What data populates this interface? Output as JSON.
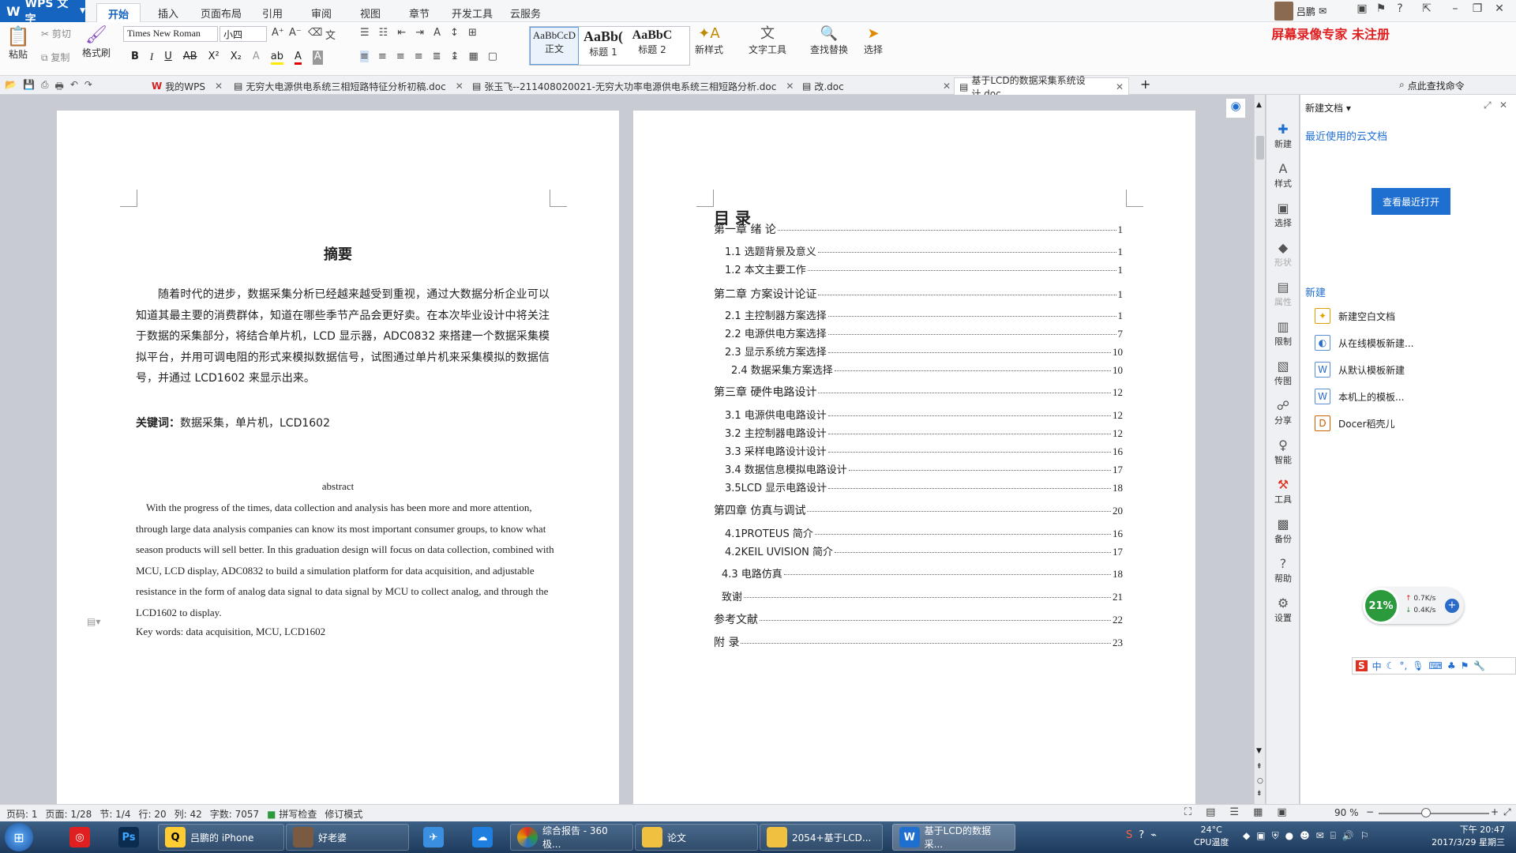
{
  "app": {
    "name": "WPS 文字",
    "logo": "W"
  },
  "menu_tabs": [
    {
      "label": "开始"
    },
    {
      "label": "插入"
    },
    {
      "label": "页面布局"
    },
    {
      "label": "引用"
    },
    {
      "label": "审阅"
    },
    {
      "label": "视图"
    },
    {
      "label": "章节"
    },
    {
      "label": "开发工具"
    },
    {
      "label": "云服务"
    }
  ],
  "user": {
    "name": "吕鹏"
  },
  "watermark": "屏幕录像专家  未注册",
  "ribbon": {
    "paste": "粘贴",
    "cut": "剪切",
    "copy": "复制",
    "format_painter": "格式刷",
    "font_name": "Times New Roman",
    "font_size": "小四",
    "styles": [
      {
        "preview": "AaBbCcD",
        "label": "正文"
      },
      {
        "preview": "AaBb(",
        "label": "标题 1"
      },
      {
        "preview": "AaBbC",
        "label": "标题 2"
      }
    ],
    "new_style": "新样式",
    "text_tools": "文字工具",
    "find_replace": "查找替换",
    "select": "选择"
  },
  "doc_tabs": [
    {
      "label": "我的WPS"
    },
    {
      "label": "无穷大电源供电系统三相短路特征分析初稿.doc"
    },
    {
      "label": "张玉飞--211408020021-无穷大功率电源供电系统三相短路分析.doc"
    },
    {
      "label": "改.doc"
    },
    {
      "label": "基于LCD的数据采集系统设计.doc"
    }
  ],
  "find_command": "点此查找命令",
  "page1": {
    "title": "摘要",
    "abstract_cn": "随着时代的进步，数据采集分析已经越来越受到重视，通过大数据分析企业可以知道其最主要的消费群体，知道在哪些季节产品会更好卖。在本次毕业设计中将关注于数据的采集部分，将结合单片机，LCD 显示器，ADC0832 来搭建一个数据采集模拟平台，并用可调电阻的形式来模拟数据信号，试图通过单片机来采集模拟的数据信号，并通过 LCD1602 来显示出来。",
    "keywords_label": "关键词：",
    "keywords": "数据采集，单片机，LCD1602",
    "abstract_en_title": "abstract",
    "abstract_en": "With the progress of the times, data collection and analysis has been more and more attention, through large data analysis companies can know its most important consumer groups, to know what season products will sell better. In this graduation design will focus on data collection, combined with MCU, LCD display, ADC0832 to build a simulation platform for data acquisition, and adjustable resistance in the form of analog data signal to data signal by MCU to collect analog, and through the LCD1602 to display.",
    "keywords_en": "Key words: data acquisition, MCU, LCD1602"
  },
  "page2": {
    "title": "目 录",
    "toc": [
      {
        "text": "第一章  绪  论",
        "page": "1"
      },
      {
        "text": "1.1 选题背景及意义",
        "page": "1"
      },
      {
        "text": "1.2 本文主要工作",
        "page": "1"
      },
      {
        "text": "第二章  方案设计论证",
        "page": "1"
      },
      {
        "text": "2.1 主控制器方案选择",
        "page": "1"
      },
      {
        "text": "2.2 电源供电方案选择",
        "page": "7"
      },
      {
        "text": "2.3  显示系统方案选择",
        "page": "10"
      },
      {
        "text": "2.4 数据采集方案选择",
        "page": "10"
      },
      {
        "text": "第三章  硬件电路设计",
        "page": "12"
      },
      {
        "text": "3.1 电源供电电路设计",
        "page": "12"
      },
      {
        "text": "3.2 主控制器电路设计",
        "page": "12"
      },
      {
        "text": "3.3 采样电路设计设计",
        "page": "16"
      },
      {
        "text": "3.4  数据信息模拟电路设计",
        "page": "17"
      },
      {
        "text": "3.5LCD 显示电路设计",
        "page": "18"
      },
      {
        "text": "第四章    仿真与调试",
        "page": "20"
      },
      {
        "text": "4.1PROTEUS 简介",
        "page": "16"
      },
      {
        "text": "4.2KEIL UVISION 简介",
        "page": "17"
      },
      {
        "text": "4.3 电路仿真",
        "page": "18"
      },
      {
        "text": "致谢",
        "page": "21"
      },
      {
        "text": "参考文献",
        "page": "22"
      },
      {
        "text": "附  录",
        "page": "23"
      }
    ]
  },
  "side_tools": [
    {
      "label": "新建"
    },
    {
      "label": "样式"
    },
    {
      "label": "选择"
    },
    {
      "label": "形状"
    },
    {
      "label": "属性"
    },
    {
      "label": "限制"
    },
    {
      "label": "传图"
    },
    {
      "label": "分享"
    },
    {
      "label": "智能"
    },
    {
      "label": "工具"
    },
    {
      "label": "备份"
    },
    {
      "label": "帮助"
    },
    {
      "label": "设置"
    }
  ],
  "right_panel": {
    "header": "新建文档",
    "recent_title": "最近使用的云文档",
    "recent_button": "查看最近打开",
    "new_title": "新建",
    "items": [
      {
        "label": "新建空白文档"
      },
      {
        "label": "从在线模板新建..."
      },
      {
        "label": "从默认模板新建"
      },
      {
        "label": "本机上的模板..."
      },
      {
        "label": "Docer稻壳儿"
      }
    ]
  },
  "net_meter": {
    "percent": "21%",
    "up": "0.7K/s",
    "down": "0.4K/s"
  },
  "status": {
    "page_num": "页码: 1",
    "page": "页面: 1/28",
    "section": "节: 1/4",
    "row": "行: 20",
    "col": "列: 42",
    "words": "字数: 7057",
    "spell": "拼写检查",
    "mode": "修订模式",
    "zoom": "90 %"
  },
  "taskbar": {
    "items": [
      {
        "label": "吕鹏的 iPhone"
      },
      {
        "label": "好老婆"
      },
      {
        "label": "综合报告 - 360极..."
      },
      {
        "label": "论文"
      },
      {
        "label": "2054+基于LCD..."
      },
      {
        "label": "基于LCD的数据采..."
      }
    ],
    "temp": "24°C",
    "temp_label": "CPU温度",
    "time": "下午 20:47",
    "date": "2017/3/29 星期三"
  }
}
